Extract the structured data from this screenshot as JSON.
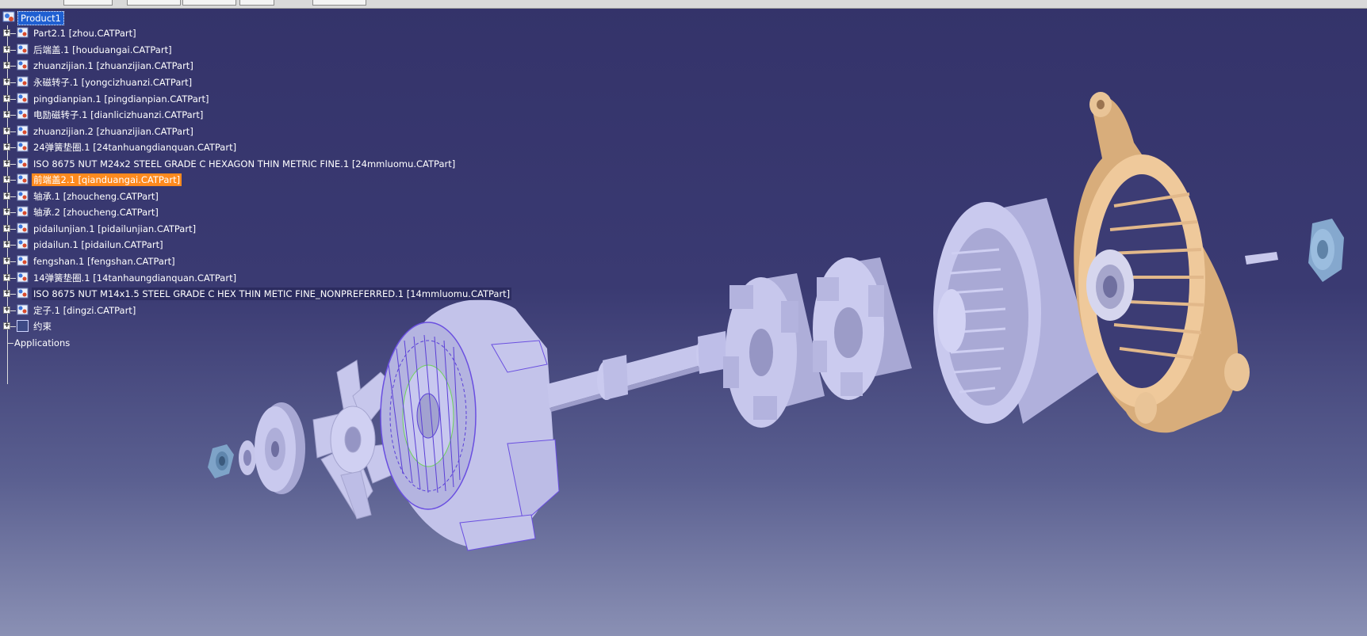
{
  "window": {
    "title": "Product1"
  },
  "toolbar": {
    "fields": [
      "",
      "",
      "",
      "",
      ""
    ]
  },
  "tree": {
    "root": {
      "label": "Product1",
      "icon": "product-icon"
    },
    "items": [
      {
        "label": "Part2.1 [zhou.CATPart]",
        "icon": "part-icon"
      },
      {
        "label": "后端盖.1 [houduangai.CATPart]",
        "icon": "part-icon"
      },
      {
        "label": "zhuanzijian.1 [zhuanzijian.CATPart]",
        "icon": "part-icon"
      },
      {
        "label": "永磁转子.1 [yongcizhuanzi.CATPart]",
        "icon": "part-icon"
      },
      {
        "label": "pingdianpian.1 [pingdianpian.CATPart]",
        "icon": "part-icon"
      },
      {
        "label": "电励磁转子.1 [dianlicizhuanzi.CATPart]",
        "icon": "part-icon"
      },
      {
        "label": "zhuanzijian.2 [zhuanzijian.CATPart]",
        "icon": "part-icon"
      },
      {
        "label": "24弹簧垫圈.1 [24tanhuangdianquan.CATPart]",
        "icon": "part-icon"
      },
      {
        "label": "ISO 8675 NUT M24x2 STEEL GRADE C HEXAGON THIN METRIC FINE.1 [24mmluomu.CATPart]",
        "icon": "part-icon"
      },
      {
        "label": "前端盖2.1 [qianduangai.CATPart]",
        "icon": "part-icon",
        "selected": true
      },
      {
        "label": "轴承.1 [zhoucheng.CATPart]",
        "icon": "part-icon"
      },
      {
        "label": "轴承.2 [zhoucheng.CATPart]",
        "icon": "part-icon"
      },
      {
        "label": "pidailunjian.1 [pidailunjian.CATPart]",
        "icon": "part-icon"
      },
      {
        "label": "pidailun.1 [pidailun.CATPart]",
        "icon": "part-icon"
      },
      {
        "label": "fengshan.1 [fengshan.CATPart]",
        "icon": "part-icon"
      },
      {
        "label": "14弹簧垫圈.1 [14tanhaungdianquan.CATPart]",
        "icon": "part-icon"
      },
      {
        "label": "ISO 8675 NUT M14x1.5 STEEL GRADE C HEX THIN METIC FINE_NONPREFERRED.1 [14mmluomu.CATPart]",
        "icon": "part-icon"
      },
      {
        "label": "定子.1 [dingzi.CATPart]",
        "icon": "part-icon"
      }
    ],
    "constraints": {
      "label": "约束",
      "icon": "constraints-icon"
    },
    "applications": {
      "label": "Applications"
    }
  },
  "colors": {
    "background_top": "#34336a",
    "background_bottom": "#8a90b4",
    "part_lavender": "#bdbde6",
    "part_tan": "#e8bf8e",
    "nut_blue": "#8fb0d4",
    "selection_orange": "#ff8a1e",
    "root_highlight": "#1f5fd1"
  }
}
